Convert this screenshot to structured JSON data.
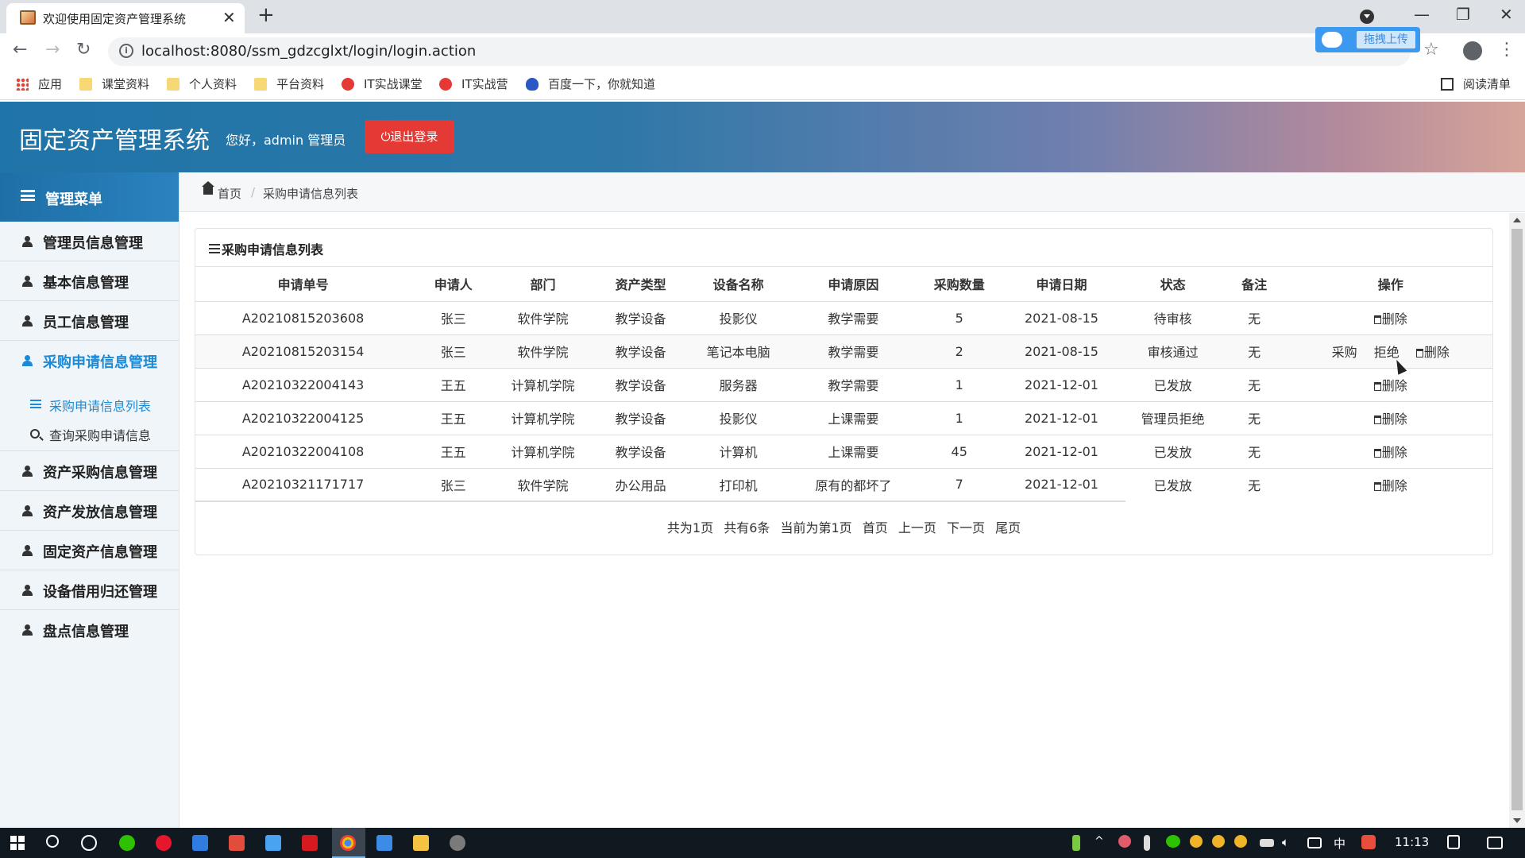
{
  "browser": {
    "tab_title": "欢迎使用固定资产管理系统",
    "tab_close": "✕",
    "new_tab": "+",
    "url": "localhost:8080/ssm_gdzcglxt/login/login.action",
    "upload_label": "拖拽上传",
    "bookmarks": [
      {
        "label": "应用",
        "icon": "apps-icon"
      },
      {
        "label": "课堂资料",
        "icon": "folder-icon"
      },
      {
        "label": "个人资料",
        "icon": "folder-icon"
      },
      {
        "label": "平台资料",
        "icon": "folder-icon"
      },
      {
        "label": "IT实战课堂",
        "icon": "it-icon"
      },
      {
        "label": "IT实战营",
        "icon": "it-icon"
      },
      {
        "label": "百度一下，你就知道",
        "icon": "baidu-icon"
      }
    ],
    "reading_list": "阅读清单"
  },
  "header": {
    "app_title": "固定资产管理系统",
    "greeting": "您好，admin 管理员",
    "logout_label": "⏻退出登录"
  },
  "sidebar": {
    "title": "管理菜单",
    "items": [
      {
        "label": "管理员信息管理"
      },
      {
        "label": "基本信息管理"
      },
      {
        "label": "员工信息管理"
      },
      {
        "label": "采购申请信息管理"
      },
      {
        "label": "资产采购信息管理"
      },
      {
        "label": "资产发放信息管理"
      },
      {
        "label": "固定资产信息管理"
      },
      {
        "label": "设备借用归还管理"
      },
      {
        "label": "盘点信息管理"
      }
    ],
    "submenu": [
      {
        "label": "采购申请信息列表"
      },
      {
        "label": "查询采购申请信息"
      }
    ]
  },
  "breadcrumb": {
    "home": "首页",
    "separator": "/",
    "current": "采购申请信息列表"
  },
  "panel": {
    "title": "采购申请信息列表"
  },
  "table": {
    "headers": [
      "申请单号",
      "申请人",
      "部门",
      "资产类型",
      "设备名称",
      "申请原因",
      "采购数量",
      "申请日期",
      "状态",
      "备注",
      "操作"
    ],
    "rows": [
      {
        "id": "A20210815203608",
        "applicant": "张三",
        "dept": "软件学院",
        "type": "教学设备",
        "device": "投影仪",
        "reason": "教学需要",
        "qty": "5",
        "date": "2021-08-15",
        "status": "待审核",
        "remark": "无"
      },
      {
        "id": "A20210815203154",
        "applicant": "张三",
        "dept": "软件学院",
        "type": "教学设备",
        "device": "笔记本电脑",
        "reason": "教学需要",
        "qty": "2",
        "date": "2021-08-15",
        "status": "审核通过",
        "remark": "无"
      },
      {
        "id": "A20210322004143",
        "applicant": "王五",
        "dept": "计算机学院",
        "type": "教学设备",
        "device": "服务器",
        "reason": "教学需要",
        "qty": "1",
        "date": "2021-12-01",
        "status": "已发放",
        "remark": "无"
      },
      {
        "id": "A20210322004125",
        "applicant": "王五",
        "dept": "计算机学院",
        "type": "教学设备",
        "device": "投影仪",
        "reason": "上课需要",
        "qty": "1",
        "date": "2021-12-01",
        "status": "管理员拒绝",
        "remark": "无"
      },
      {
        "id": "A20210322004108",
        "applicant": "王五",
        "dept": "计算机学院",
        "type": "教学设备",
        "device": "计算机",
        "reason": "上课需要",
        "qty": "45",
        "date": "2021-12-01",
        "status": "已发放",
        "remark": "无"
      },
      {
        "id": "A20210321171717",
        "applicant": "张三",
        "dept": "软件学院",
        "type": "办公用品",
        "device": "打印机",
        "reason": "原有的都坏了",
        "qty": "7",
        "date": "2021-12-01",
        "status": "已发放",
        "remark": "无"
      }
    ],
    "actions": {
      "purchase": "采购",
      "reject": "拒绝",
      "delete": "删除"
    }
  },
  "pagination": {
    "total_pages": "共为1页",
    "total_records": "共有6条",
    "current": "当前为第1页",
    "first": "首页",
    "prev": "上一页",
    "next": "下一页",
    "last": "尾页"
  },
  "taskbar": {
    "clock": "11:13",
    "ime": "中"
  },
  "colors": {
    "accent": "#1c8ad6",
    "logout_red": "#e53935",
    "header_start": "#1f74a8",
    "header_end": "#d6a59a"
  }
}
